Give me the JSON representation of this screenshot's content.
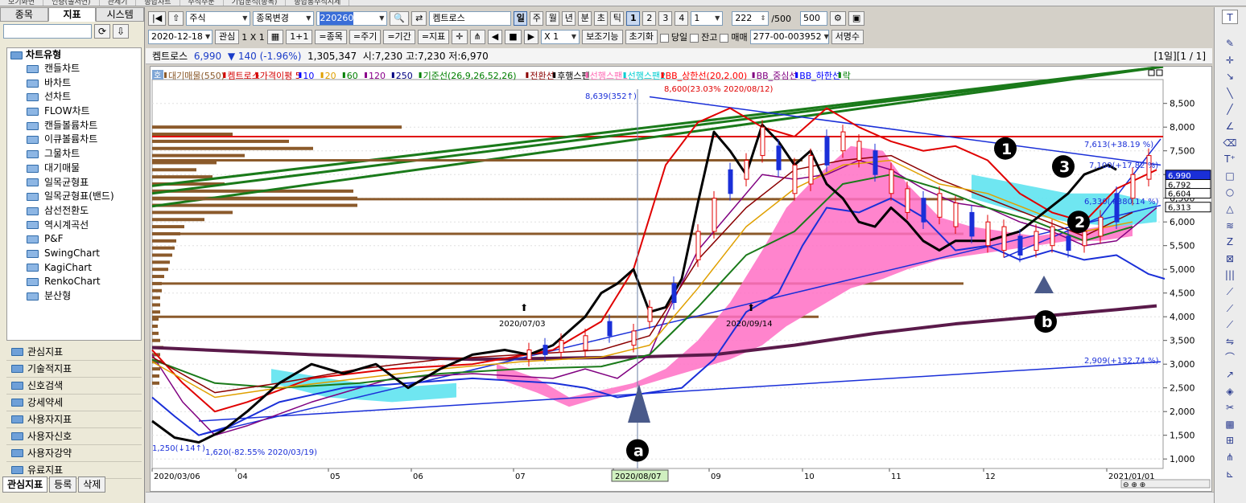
{
  "top_tabs": [
    "보기화면",
    "인증(솔저연)",
    "관세기",
    "종합차트",
    "주식주문",
    "기업분석(종목)",
    "종합통주식시세"
  ],
  "left": {
    "tabs": [
      "종목",
      "지표",
      "시스템"
    ],
    "tree_title": "차트유형",
    "tree_items": [
      "캔들차트",
      "바차트",
      "선차트",
      "FLOW차트",
      "캔들볼륨차트",
      "이큐볼륨차트",
      "그물차트",
      "대기매물",
      "일목균형표",
      "일목균형표(밴드)",
      "삼선전환도",
      "역시계곡선",
      "P&F",
      "SwingChart",
      "KagiChart",
      "RenkoChart",
      "분산형"
    ],
    "groups": [
      "관심지표",
      "기술적지표",
      "신호검색",
      "강세약세",
      "사용자지표",
      "사용자신호",
      "사용자강약",
      "유료지표"
    ],
    "bottom": [
      "관심지표",
      "등록",
      "삭제"
    ]
  },
  "toolbar1": {
    "market": "주식",
    "change_label": "종목변경",
    "code": "220260",
    "name": "켐트로스",
    "periods": [
      "일",
      "주",
      "월",
      "년",
      "분",
      "초",
      "틱"
    ],
    "nums": [
      "1",
      "2",
      "3",
      "4"
    ],
    "count_sel": "1",
    "bars": "222",
    "total": "/500",
    "view": "500"
  },
  "toolbar2": {
    "date": "2020-12-18",
    "fav": "관심",
    "grid": "1 X 1",
    "btns": [
      "=종목",
      "=주기",
      "=기간",
      "=지표"
    ],
    "mult": "X 1",
    "assist": "보조기능",
    "reset": "초기화",
    "dangil": "당일",
    "jango": "잔고",
    "maemae": "매매",
    "account": "277-00-003952",
    "sign": "서명수"
  },
  "info": {
    "name": "켐트로스",
    "price": "6,990",
    "change": "▼ 140 (-1.96%)",
    "volume": "1,305,347",
    "open": "시:7,230",
    "high": "고:7,230",
    "low": "저:6,970",
    "page": "[1일][1 / 1]"
  },
  "chart_data": {
    "type": "line",
    "legend": [
      "대기매물(550)",
      "켐트로스",
      "가격이평 5",
      "10",
      "20",
      "60",
      "120",
      "250",
      "기준선(26,9,26,52,26)",
      "전환선",
      "후행스팬",
      "선행스팬1",
      "선행스팬2",
      "BB_상한선(20,2.00)",
      "BB_중심선",
      "BB_하한선",
      "락"
    ],
    "legend_colors": [
      "#8b5a2b",
      "#d40000",
      "#d40000",
      "#0000ff",
      "#e0a000",
      "#008000",
      "#8b008b",
      "#000080",
      "#008000",
      "#8b0000",
      "#000000",
      "#ff69b4",
      "#00ced1",
      "#ff0000",
      "#800080",
      "#0000ff",
      "#008000"
    ],
    "y_ticks": [
      8500,
      8000,
      7500,
      7000,
      6500,
      6000,
      5500,
      5000,
      4500,
      4000,
      3500,
      3000,
      2500,
      2000,
      1500,
      1000
    ],
    "ylim": [
      800,
      8800
    ],
    "x_labels": [
      "2020/03/06",
      "04",
      "05",
      "06",
      "07",
      "2020/08/07",
      "09",
      "10",
      "11",
      "12",
      "2021/01/01"
    ],
    "price_tags": [
      "6,990",
      "6,792",
      "6,604",
      "6,313"
    ],
    "annotations": {
      "max": "8,639(352↑)",
      "max2": "8,600(23.03% 2020/08/12)",
      "min": "1,250(↓14↑)",
      "min2": "1,620(-82.55% 2020/03/19)",
      "t1": "7,613(+38.19 %)",
      "t2": "7,100(+17.82 %)",
      "t3": "6,330(+380.14 %)",
      "t4": "2,909(+132.74 %)",
      "d1": "2020/07/03",
      "d2": "2020/09/14",
      "ho": "호"
    },
    "markers": [
      "1",
      "2",
      "3",
      "a",
      "b"
    ]
  }
}
